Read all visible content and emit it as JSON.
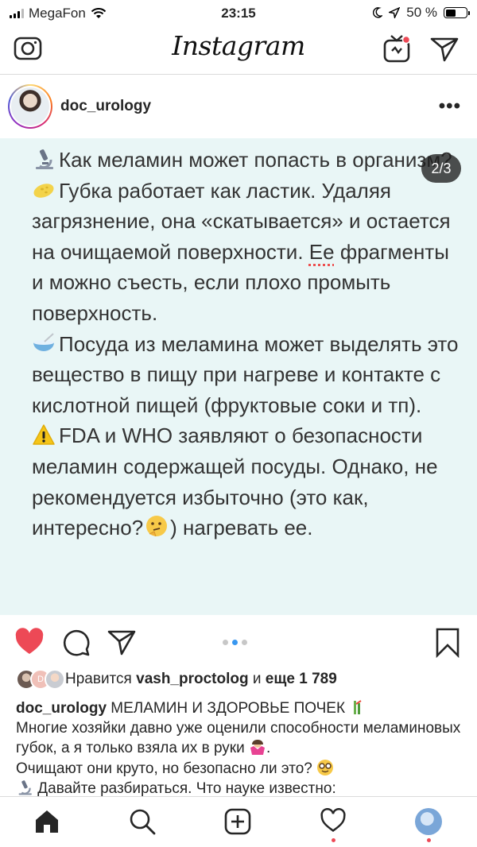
{
  "status_bar": {
    "carrier": "MegaFon",
    "time": "23:15",
    "battery": "50 %",
    "battery_level": 0.5
  },
  "header": {
    "logo": "Instagram",
    "camera_icon": "camera-icon",
    "igtv_icon": "igtv-icon",
    "direct_icon": "paper-plane-icon"
  },
  "post": {
    "username": "doc_urology",
    "more_label": "•••",
    "slide_counter": "2/3",
    "slide_index": 2,
    "slide_total": 3,
    "image_lines": {
      "l1_emoji": "microscope",
      "l1": "Как меламин может попасть в организм?",
      "l2_emoji": "sponge",
      "l2a": "Губка работает как ластик. Удаляя загрязнение, она «скатывается» и остается на очищаемой поверхности. ",
      "l2_word": "Ее",
      "l2b": " фрагменты и можно съесть, если плохо промыть поверхность.",
      "l3_emoji": "bowl",
      "l3": "Посуда из меламина может выделять это вещество в пищу при нагреве и контакте с кислотной пищей (фруктовые соки и тп).",
      "l4_emoji": "warning",
      "l4a": "FDA и WHO заявляют о безопасности меламин содержащей посуды. Однако, не рекомендуется избыточно (это как, интересно?",
      "l4_emoji2": "thinking-face",
      "l4b": ") нагревать ее."
    },
    "likes": {
      "prefix": "Нравится ",
      "user": "vash_proctolog",
      "middle": " и ",
      "count": "еще 1 789"
    },
    "caption": {
      "user": "doc_urology",
      "title": " МЕЛАМИН И ЗДОРОВЬЕ ПОЧЕК",
      "title_emoji": "bamboo",
      "l1": "Многие хозяйки давно уже оценили способности меламиновых губок, а я только взяла их в руки",
      "l1_emoji": "shrug",
      "l1_end": ".",
      "l2": "Очищают они круто, но безопасно ли это?",
      "l2_emoji": "nerd-face",
      "l3_emoji": "microscope",
      "l3": "Давайте разбираться. Что науке известно:"
    }
  },
  "tab_bar": {
    "items": [
      "home-icon",
      "search-icon",
      "add-post-icon",
      "activity-heart-icon",
      "profile-avatar"
    ]
  },
  "colors": {
    "like_red": "#ed4956",
    "accent_blue": "#3897f0",
    "image_bg": "#e9f6f6"
  }
}
